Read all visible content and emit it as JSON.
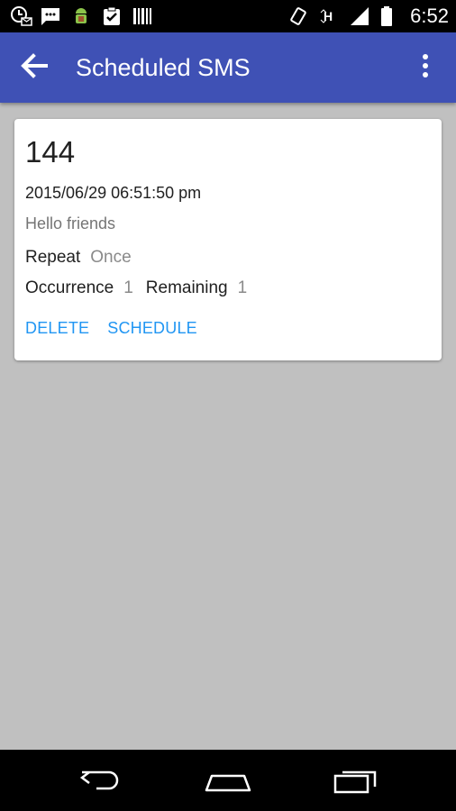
{
  "status_bar": {
    "time": "6:52",
    "left_icons": [
      "clock-mail-icon",
      "sms-icon",
      "android-debug-icon",
      "clipboard-check-icon",
      "barcode-icon"
    ],
    "right_icons": [
      "vibrate-icon",
      "h-network-icon",
      "signal-icon",
      "battery-icon"
    ]
  },
  "app_bar": {
    "title": "Scheduled SMS",
    "back_icon": "arrow-back-icon",
    "menu_icon": "more-vert-icon",
    "color": "#3f51b5"
  },
  "card": {
    "number": "144",
    "datetime": "2015/06/29 06:51:50 pm",
    "message": "Hello friends",
    "repeat_label": "Repeat",
    "repeat_value": "Once",
    "occurrence_label": "Occurrence",
    "occurrence_value": "1",
    "remaining_label": "Remaining",
    "remaining_value": "1",
    "delete_label": "DELETE",
    "schedule_label": "SCHEDULE",
    "accent": "#2196f3"
  },
  "nav_bar": {
    "icons": [
      "back-nav-icon",
      "home-nav-icon",
      "recents-nav-icon"
    ]
  }
}
